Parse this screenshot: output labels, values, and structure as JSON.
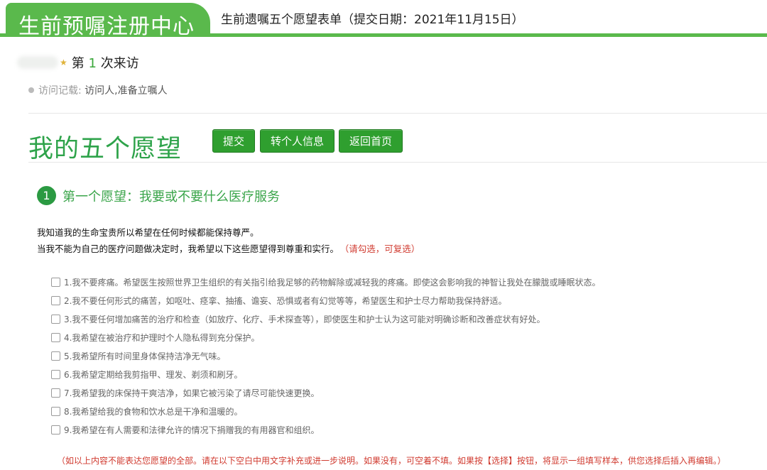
{
  "header": {
    "brand": "生前预嘱注册中心",
    "form_title": "生前遗嘱五个愿望表单（提交日期：2021年11月15日）"
  },
  "visitor": {
    "prefix": "第",
    "count": "1",
    "suffix": "次来访",
    "icon": "star-icon"
  },
  "record": {
    "label": "访问记载:",
    "value": "访问人,准备立嘱人"
  },
  "main": {
    "heading": "我的五个愿望",
    "buttons": {
      "submit": "提交",
      "personal_info": "转个人信息",
      "home": "返回首页"
    }
  },
  "section": {
    "number": "1",
    "title": "第一个愿望：我要或不要什么医疗服务",
    "intro_line1": "我知道我的生命宝贵所以希望在任何时候都能保持尊严。",
    "intro_line2": "当我不能为自己的医疗问题做决定时，我希望以下这些愿望得到尊重和实行。",
    "hint": "（请勾选，可复选）"
  },
  "options": [
    {
      "text": "1.我不要疼痛。希望医生按照世界卫生组织的有关指引给我足够的药物解除或减轻我的疼痛。即使这会影响我的神智让我处在朦胧或睡眠状态。",
      "checked": false
    },
    {
      "text": "2.我不要任何形式的痛苦，如呕吐、痉挛、抽搐、谵妄、恐惧或者有幻觉等等，希望医生和护士尽力帮助我保持舒适。",
      "checked": false
    },
    {
      "text": "3.我不要任何增加痛苦的治疗和检查（如放疗、化疗、手术探查等），即使医生和护士认为这可能对明确诊断和改善症状有好处。",
      "checked": false
    },
    {
      "text": "4.我希望在被治疗和护理时个人隐私得到充分保护。",
      "checked": false
    },
    {
      "text": "5.我希望所有时间里身体保持洁净无气味。",
      "checked": false
    },
    {
      "text": "6.我希望定期给我剪指甲、理发、剃须和刷牙。",
      "checked": false
    },
    {
      "text": "7.我希望我的床保持干爽洁净，如果它被污染了请尽可能快速更换。",
      "checked": false
    },
    {
      "text": "8.我希望给我的食物和饮水总是干净和温暖的。",
      "checked": false
    },
    {
      "text": "9.我希望在有人需要和法律允许的情况下捐赠我的有用器官和组织。",
      "checked": false
    }
  ],
  "footnote": "（如以上内容不能表达您愿望的全部。请在以下空白中用文字补充或进一步说明。如果没有，可空着不填。如果按【选择】按钮，将显示一组填写样本，供您选择后插入再编辑。）",
  "colors": {
    "brand_green": "#5ab94c",
    "button_green": "#2f9f2f",
    "heading_green": "#2ea34a",
    "hint_red": "#d03a2f"
  }
}
